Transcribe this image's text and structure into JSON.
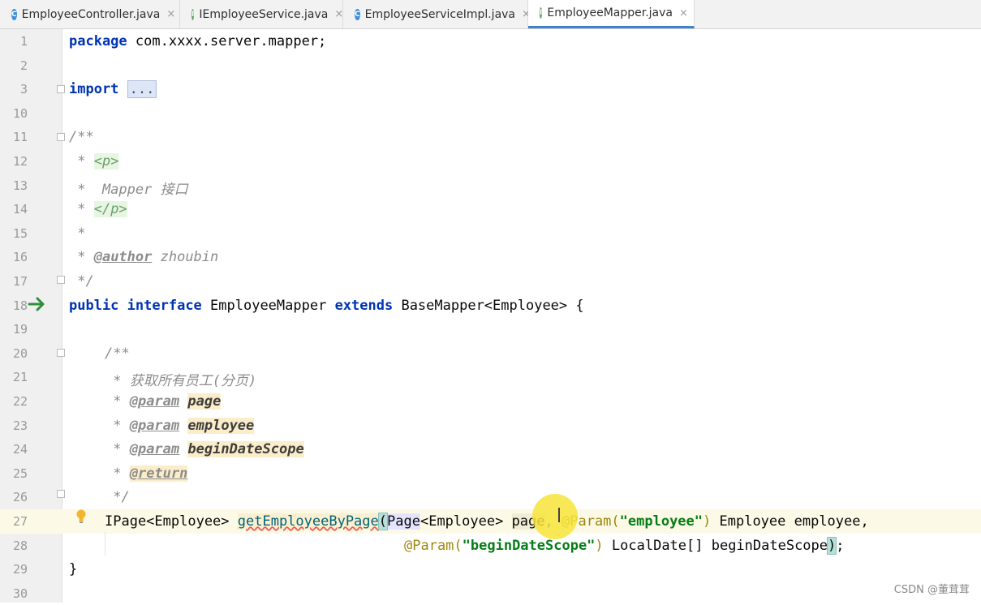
{
  "tabs": [
    {
      "label": "EmployeeController.java",
      "icon": "class-icon",
      "active": false
    },
    {
      "label": "IEmployeeService.java",
      "icon": "interface-icon",
      "active": false
    },
    {
      "label": "EmployeeServiceImpl.java",
      "icon": "class-icon",
      "active": false
    },
    {
      "label": "EmployeeMapper.java",
      "icon": "interface-icon",
      "active": true
    }
  ],
  "editor": {
    "line_numbers": [
      "1",
      "2",
      "3",
      "10",
      "11",
      "12",
      "13",
      "14",
      "15",
      "16",
      "17",
      "18",
      "19",
      "20",
      "21",
      "22",
      "23",
      "24",
      "25",
      "26",
      "27",
      "28",
      "29",
      "30"
    ],
    "line1": {
      "kw": "package",
      "rest": " com.xxxx.server.mapper;"
    },
    "line3": {
      "kw": "import",
      "fold": "..."
    },
    "line11": "/**",
    "line12": {
      "prefix": " * ",
      "tag": "<p>"
    },
    "line13": " *  Mapper 接口",
    "line14": {
      "prefix": " * ",
      "tag": "</p>"
    },
    "line15": " *",
    "line16": {
      "prefix": " * ",
      "tag": "@author",
      "value": " zhoubin"
    },
    "line17": " */",
    "line18": {
      "kw1": "public",
      "kw2": "interface",
      "name": " EmployeeMapper ",
      "kw3": "extends",
      "rest": " BaseMapper<Employee> {"
    },
    "line20": "/**",
    "line21": " * 获取所有员工(分页)",
    "line22": {
      "prefix": " * ",
      "tag": "@param",
      "value": "page"
    },
    "line23": {
      "prefix": " * ",
      "tag": "@param",
      "value": "employee"
    },
    "line24": {
      "prefix": " * ",
      "tag": "@param",
      "value": "beginDateScope"
    },
    "line25": {
      "prefix": " * ",
      "tag": "@return"
    },
    "line26": " */",
    "line27": {
      "ret": "IPage<Employee> ",
      "method": "getEmployeeByPage",
      "paren": "(",
      "type1": "Page",
      "type1b": "<Employee> ",
      "p1": "page",
      "comma": ", ",
      "ann": "@Param(",
      "str": "\"employee\"",
      "close": ")",
      "rest": " Employee employee,"
    },
    "line28": {
      "ann": "@Param(",
      "str": "\"beginDateScope\"",
      "close": ")",
      "rest": " LocalDate[] beginDateScope",
      "paren": ")",
      "semi": ";"
    },
    "line29": "}"
  },
  "watermark": "CSDN @董茸茸",
  "colors": {
    "keyword": "#0033b3",
    "comment": "#8c8c8c",
    "string": "#067d17",
    "annotation": "#9e880d",
    "active_tab": "#4083c9"
  }
}
